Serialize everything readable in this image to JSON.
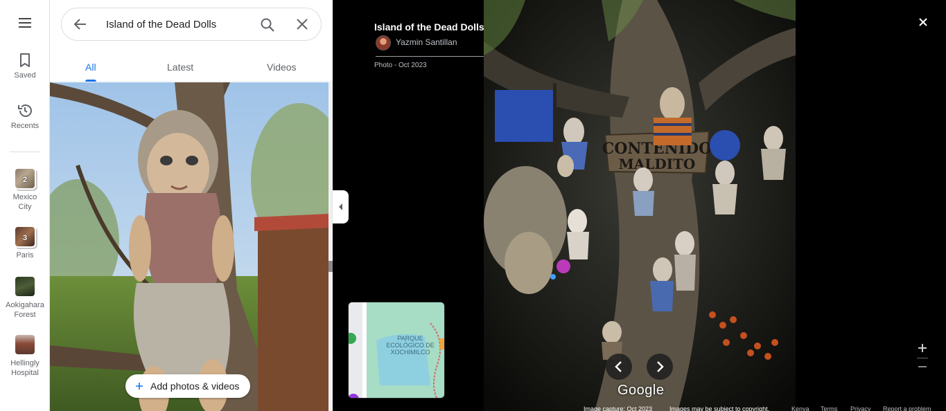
{
  "search": {
    "query": "Island of the Dead Dolls"
  },
  "tabs": {
    "all": "All",
    "latest": "Latest",
    "videos": "Videos"
  },
  "rail": {
    "saved": "Saved",
    "recents": "Recents",
    "places": [
      {
        "label_1": "Mexico",
        "label_2": "City",
        "count": "2"
      },
      {
        "label": "Paris",
        "count": "3"
      },
      {
        "label_1": "Aokigahara",
        "label_2": "Forest"
      },
      {
        "label_1": "Hellingly",
        "label_2": "Hospital"
      }
    ]
  },
  "panel": {
    "add_photos": "Add photos & videos"
  },
  "photo_info": {
    "title": "Island of the Dead Dolls",
    "author": "Yazmin Santillan",
    "date": "Photo - Oct 2023"
  },
  "minimap": {
    "label_1": "PARQUE",
    "label_2": "ECOLÓGICO DE",
    "label_3": "XOCHIMILCO"
  },
  "viewer": {
    "sign_line1": "CONTENIDO",
    "sign_line2": "MALDITO",
    "brand": "Google"
  },
  "footer": {
    "capture": "Image capture: Oct 2023",
    "copyright": "Images may be subject to copyright.",
    "country": "Kenya",
    "terms": "Terms",
    "privacy": "Privacy",
    "report": "Report a problem"
  },
  "colors": {
    "accent": "#1a73e8",
    "panel_bg": "#ffffff",
    "viewer_bg": "#000000"
  }
}
